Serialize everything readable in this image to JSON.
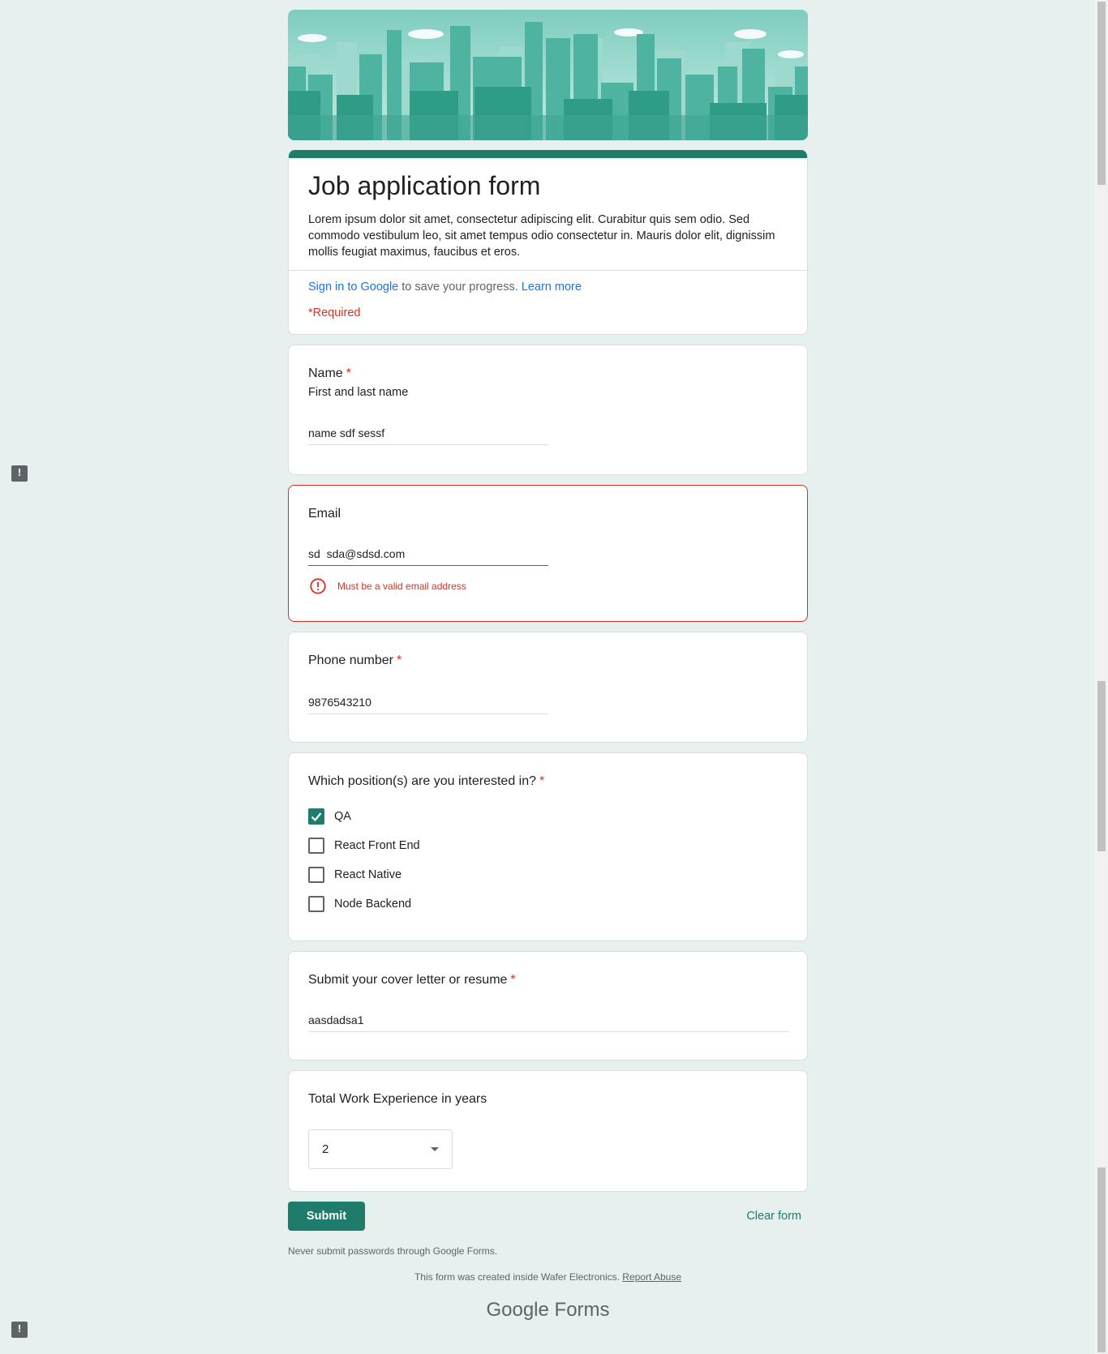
{
  "form": {
    "title": "Job application form",
    "description": "Lorem ipsum dolor sit amet, consectetur adipiscing elit. Curabitur quis sem odio. Sed commodo vestibulum leo, sit amet tempus odio consectetur in. Mauris dolor elit, dignissim mollis feugiat maximus, faucibus et eros.",
    "sign_in_link": "Sign in to Google",
    "sign_in_text": " to save your progress. ",
    "learn_more": "Learn more",
    "required_note": "*Required"
  },
  "questions": {
    "name": {
      "title": "Name",
      "star": "*",
      "help": "First and last name",
      "value": "name sdf sessf"
    },
    "email": {
      "title": "Email",
      "value": "sd  sda@sdsd.com",
      "error": "Must be a valid email address"
    },
    "phone": {
      "title": "Phone number",
      "star": "*",
      "value": "9876543210"
    },
    "positions": {
      "title": "Which position(s) are you interested in?",
      "star": "*",
      "options": [
        {
          "label": "QA",
          "checked": true
        },
        {
          "label": "React Front End",
          "checked": false
        },
        {
          "label": "React Native",
          "checked": false
        },
        {
          "label": "Node Backend",
          "checked": false
        }
      ]
    },
    "resume": {
      "title": "Submit your cover letter or resume",
      "star": "*",
      "value": "aasdadsa1"
    },
    "experience": {
      "title": "Total Work Experience in years",
      "selected": "2"
    }
  },
  "actions": {
    "submit": "Submit",
    "clear": "Clear form"
  },
  "footer": {
    "never": "Never submit passwords through Google Forms.",
    "created": "This form was created inside Wafer Electronics.",
    "report": "Report Abuse",
    "brand_google": "Google",
    "brand_forms": "Forms"
  },
  "colors": {
    "accent": "#1e7c6a",
    "error": "#d93025",
    "link": "#1a73e8",
    "background": "#e6f0ef"
  },
  "icons": {
    "error": "error-circle-icon",
    "feedback": "feedback-icon",
    "dropdown": "dropdown-caret-icon",
    "check": "checkmark-icon"
  }
}
